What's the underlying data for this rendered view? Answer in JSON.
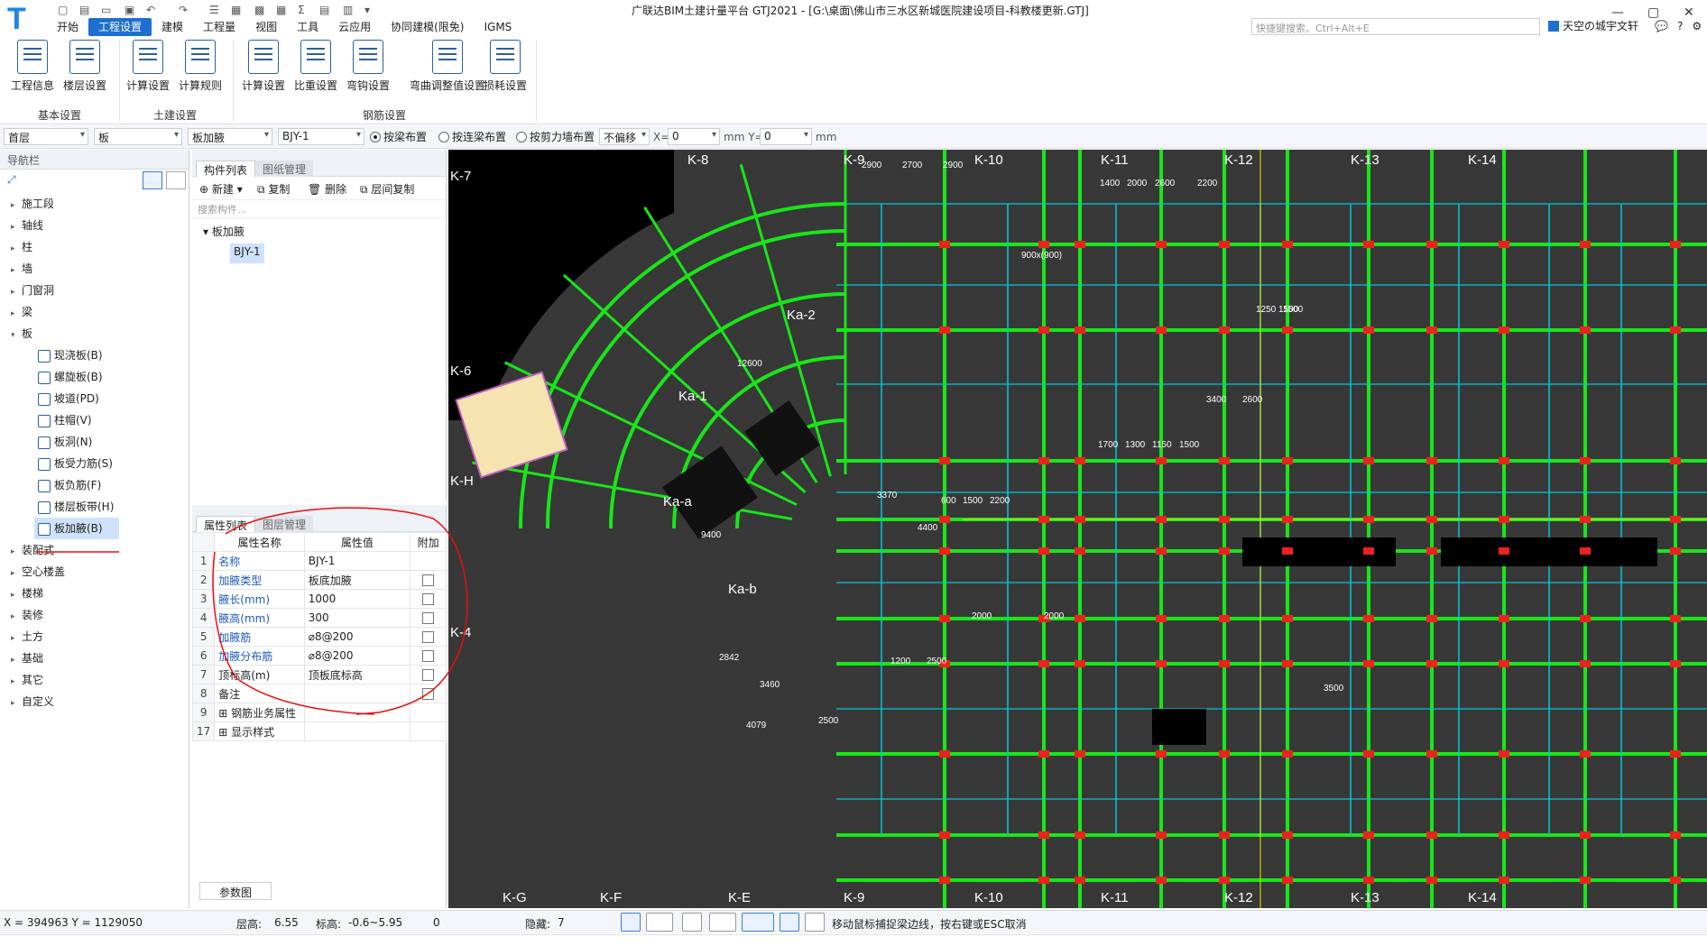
{
  "window": {
    "title": "广联达BIM土建计量平台 GTJ2021 - [G:\\桌面\\佛山市三水区新城医院建设项目-科教楼更新.GTJ]"
  },
  "menu": [
    "开始",
    "工程设置",
    "建模",
    "工程量",
    "视图",
    "工具",
    "云应用",
    "协同建模(限免)",
    "IGMS"
  ],
  "search": {
    "placeholder": "快捷键搜索、Ctrl+Alt+E"
  },
  "user": {
    "name": "天空の城宇文轩"
  },
  "ribbon": {
    "buttons": [
      {
        "label": "工程信息",
        "icon": "project-info-icon"
      },
      {
        "label": "楼层设置",
        "icon": "floor-settings-icon"
      },
      {
        "label": "计算设置",
        "icon": "calc-settings-icon"
      },
      {
        "label": "计算规则",
        "icon": "calc-rules-icon"
      },
      {
        "label": "计算设置",
        "icon": "rebar-calc-settings-icon"
      },
      {
        "label": "比重设置",
        "icon": "density-settings-icon"
      },
      {
        "label": "弯钩设置",
        "icon": "hook-settings-icon"
      },
      {
        "label": "弯曲调整值设置",
        "icon": "bend-adjust-icon"
      },
      {
        "label": "损耗设置",
        "icon": "loss-settings-icon"
      }
    ],
    "groups": [
      "基本设置",
      "土建设置",
      "钢筋设置"
    ]
  },
  "propbar": {
    "floor": "首层",
    "category": "板",
    "type": "板加腋",
    "component": "BJY-1",
    "radios": [
      "按梁布置",
      "按连梁布置",
      "按剪力墙布置"
    ],
    "offset": "不偏移",
    "x_label": "X=",
    "x_value": "0",
    "y_label": "mm Y=",
    "y_value": "0",
    "unit": "mm"
  },
  "nav": {
    "title": "导航栏",
    "items": [
      "施工段",
      "轴线",
      "柱",
      "墙",
      "门窗洞",
      "梁",
      "板"
    ],
    "sub_items": [
      "现浇板(B)",
      "螺旋板(B)",
      "坡道(PD)",
      "柱帽(V)",
      "板洞(N)",
      "板受力筋(S)",
      "板负筋(F)",
      "楼层板带(H)",
      "板加腋(B)"
    ],
    "items_after": [
      "装配式",
      "空心楼盖",
      "楼梯",
      "装修",
      "土方",
      "基础",
      "其它",
      "自定义"
    ]
  },
  "complist": {
    "tabs": [
      "构件列表",
      "图纸管理"
    ],
    "toolbar": [
      "新建",
      "复制",
      "删除",
      "层间复制"
    ],
    "search_placeholder": "搜索构件...",
    "tree_root": "板加腋",
    "tree_child": "BJY-1"
  },
  "props": {
    "tabs": [
      "属性列表",
      "图层管理"
    ],
    "headers": [
      "属性名称",
      "属性值",
      "附加"
    ],
    "rows": [
      {
        "n": "1",
        "k": "名称",
        "v": "BJY-1",
        "blue": true,
        "chk": false
      },
      {
        "n": "2",
        "k": "加腋类型",
        "v": "板底加腋",
        "blue": true,
        "chk": true
      },
      {
        "n": "3",
        "k": "腋长(mm)",
        "v": "1000",
        "blue": true,
        "chk": true
      },
      {
        "n": "4",
        "k": "腋高(mm)",
        "v": "300",
        "blue": true,
        "chk": true
      },
      {
        "n": "5",
        "k": "加腋筋",
        "v": "⌀8@200",
        "blue": true,
        "chk": true
      },
      {
        "n": "6",
        "k": "加腋分布筋",
        "v": "⌀8@200",
        "blue": true,
        "chk": true
      },
      {
        "n": "7",
        "k": "顶标高(m)",
        "v": "顶板底标高",
        "blue": false,
        "chk": true
      },
      {
        "n": "8",
        "k": "备注",
        "v": "",
        "blue": false,
        "chk": true
      },
      {
        "n": "9",
        "k": "⊞ 钢筋业务属性",
        "v": "",
        "blue": false,
        "chk": false
      },
      {
        "n": "17",
        "k": "⊞ 显示样式",
        "v": "",
        "blue": false,
        "chk": false
      }
    ],
    "footer_button": "参数图"
  },
  "canvas": {
    "axis_top": [
      "K-8",
      "K-9",
      "K-10",
      "K-11",
      "K-12",
      "K-13",
      "K-14"
    ],
    "axis_bottom": [
      "K-G",
      "K-F",
      "K-E",
      "K-9",
      "K-10",
      "K-11",
      "K-12",
      "K-13",
      "K-14"
    ],
    "axis_left": [
      "K-7",
      "K-6",
      "K-H",
      "K-4"
    ],
    "arc_labels": [
      "Ka-2",
      "Ka-1",
      "Ka-a",
      "Ka-b"
    ],
    "dims": [
      "2900",
      "2700",
      "2900",
      "1400",
      "2000",
      "2600",
      "2200",
      "900x(900)",
      "1250",
      "1500",
      "1700",
      "1300",
      "1150",
      "1500",
      "3400",
      "2600",
      "1500",
      "3370",
      "4400",
      "600",
      "1500",
      "2200",
      "2000",
      "2000",
      "2842",
      "3460",
      "4079",
      "2500",
      "3500",
      "12600",
      "9400",
      "1200",
      "2500"
    ],
    "grid_colors": {
      "beam": "#19e619",
      "cyan": "#00c8d8",
      "yellow": "#e8e800",
      "red": "#ee2020",
      "magenta": "#c060c0",
      "bg": "#383838"
    }
  },
  "status": {
    "coords": "X = 394963 Y = 1129050",
    "floor_height_label": "层高:",
    "floor_height": "6.55",
    "elev_label": "标高:",
    "elev": "-0.6~5.95",
    "zero": "0",
    "hidden_label": "隐藏:",
    "hidden": "7",
    "hint": "移动鼠标捕捉梁边线，按右键或ESC取消"
  }
}
